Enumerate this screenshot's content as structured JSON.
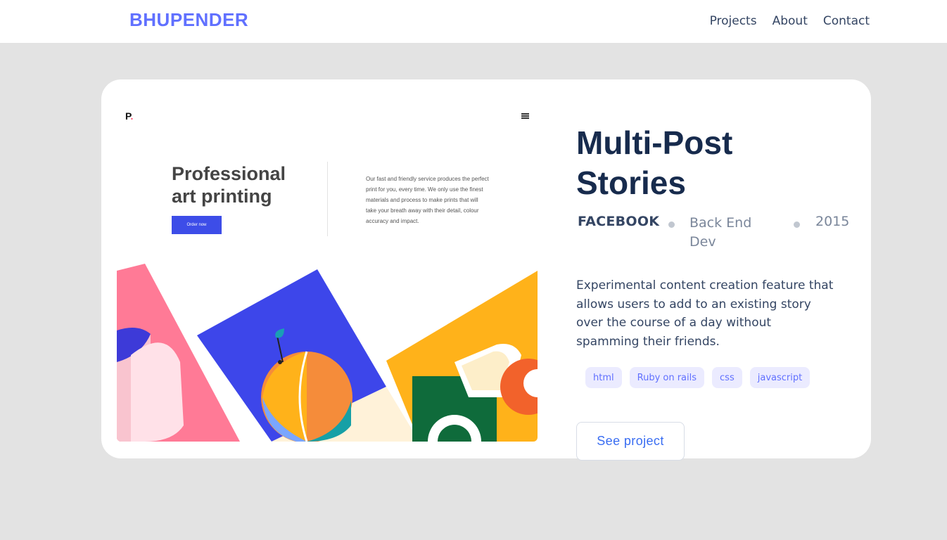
{
  "nav": {
    "logo": "BHUPENDER",
    "links": [
      "Projects",
      "About",
      "Contact"
    ]
  },
  "card": {
    "preview": {
      "logo_letter": "P",
      "logo_dot": ".",
      "headline": "Professional art printing",
      "button_label": "Order now",
      "description": "Our fast and friendly service produces the perfect print for you, every time. We only use the finest materials and process to make prints that will take your breath away with their detail, colour accuracy and impact."
    },
    "title": "Multi-Post Stories",
    "client": "FACEBOOK",
    "role": "Back End Dev",
    "year": "2015",
    "description": "Experimental content creation feature that allows users to add to an existing story over the course of a day without spamming their friends.",
    "tags": [
      "html",
      "Ruby on rails",
      "css",
      "javascript"
    ],
    "cta": "See project"
  },
  "colors": {
    "page_bg": "#e3e3e3",
    "logo": "#6070ff",
    "title": "#172b4d",
    "tag_bg": "#ebebff",
    "tag_text": "#6070ff",
    "cta_text": "#396df2"
  }
}
